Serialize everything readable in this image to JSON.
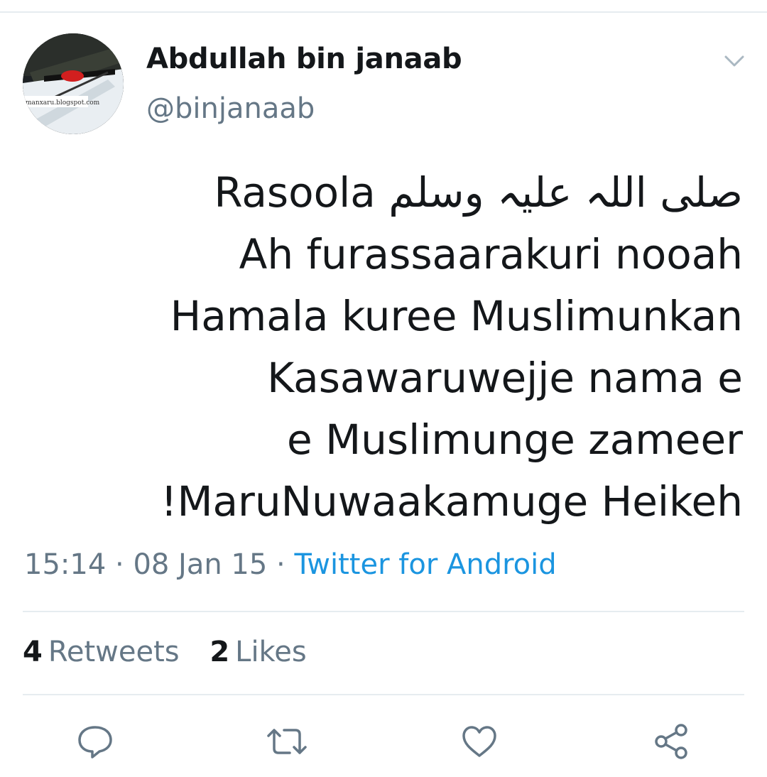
{
  "tweet": {
    "author": {
      "display_name": "Abdullah bin janaab",
      "handle": "@binjanaab",
      "avatar_text": "manxaru.blogspot.com"
    },
    "text_lines": [
      "Rasoola صلی اللہ علیہ وسلم",
      "Ah furassaarakuri nooah",
      "Hamala kuree Muslimunkan",
      "Kasawaruwejje nama e",
      "e Muslimunge zameer",
      "!MaruNuwaakamuge Heikeh"
    ],
    "time": "15:14",
    "date": "08 Jan 15",
    "separator": "·",
    "source": "Twitter for Android",
    "retweets": {
      "count": "4",
      "label": "Retweets"
    },
    "likes": {
      "count": "2",
      "label": "Likes"
    }
  },
  "icons": {
    "caret": "chevron-down-icon",
    "reply": "reply-icon",
    "retweet": "retweet-icon",
    "like": "heart-icon",
    "share": "share-icon"
  },
  "colors": {
    "text": "#14171a",
    "secondary": "#657786",
    "link": "#1b95e0",
    "divider": "#e6ecf0"
  }
}
